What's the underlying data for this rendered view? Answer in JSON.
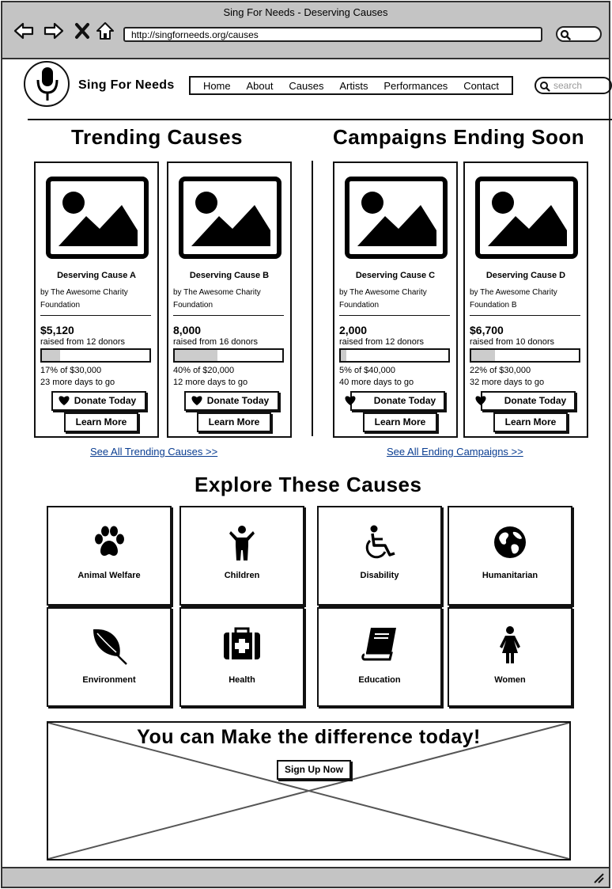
{
  "browser": {
    "window_title": "Sing For Needs - Deserving Causes",
    "url": "http://singforneeds.org/causes"
  },
  "header": {
    "site_name": "Sing For Needs",
    "nav": [
      "Home",
      "About",
      "Causes",
      "Artists",
      "Performances",
      "Contact"
    ],
    "search_placeholder": "search"
  },
  "trending": {
    "title": "Trending Causes",
    "see_all": "See All Trending Causes >>",
    "cards": [
      {
        "title": "Deserving Cause A",
        "org_line1": "by The Awesome Charity",
        "org_line2": "Foundation",
        "amount": "$5,120",
        "raised": "raised from 12 donors",
        "progress": 0.17,
        "pct": "17% of $30,000",
        "days": "23 more days to go",
        "donate": "Donate Today",
        "learn": "Learn More"
      },
      {
        "title": "Deserving Cause B",
        "org_line1": "by The Awesome Charity",
        "org_line2": "Foundation",
        "amount": "8,000",
        "raised": "raised from 16 donors",
        "progress": 0.4,
        "pct": "40% of $20,000",
        "days": "12 more days to go",
        "donate": "Donate Today",
        "learn": "Learn More"
      }
    ]
  },
  "ending": {
    "title": "Campaigns Ending Soon",
    "see_all": "See All Ending Campaigns >>",
    "cards": [
      {
        "title": "Deserving Cause C",
        "org_line1": "by The Awesome Charity",
        "org_line2": "Foundation",
        "amount": "2,000",
        "raised": "raised from 12 donors",
        "progress": 0.05,
        "pct": "5% of $40,000",
        "days": "40 more days to go",
        "donate": "Donate Today",
        "learn": "Learn More"
      },
      {
        "title": "Deserving Cause D",
        "org_line1": "by The Awesome Charity",
        "org_line2": "Foundation B",
        "amount": "$6,700",
        "raised": "raised from 10 donors",
        "progress": 0.22,
        "pct": "22% of $30,000",
        "days": "32 more days to go",
        "donate": "Donate Today",
        "learn": "Learn More"
      }
    ]
  },
  "explore": {
    "title": "Explore These Causes",
    "categories": [
      {
        "label": "Animal Welfare",
        "icon": "paw-icon"
      },
      {
        "label": "Children",
        "icon": "child-icon"
      },
      {
        "label": "Disability",
        "icon": "wheelchair-icon"
      },
      {
        "label": "Humanitarian",
        "icon": "globe-icon"
      },
      {
        "label": "Environment",
        "icon": "leaf-icon"
      },
      {
        "label": "Health",
        "icon": "medkit-icon"
      },
      {
        "label": "Education",
        "icon": "book-icon"
      },
      {
        "label": "Women",
        "icon": "female-icon"
      }
    ]
  },
  "banner": {
    "text": "You can Make the difference today!",
    "signup": "Sign Up Now"
  }
}
